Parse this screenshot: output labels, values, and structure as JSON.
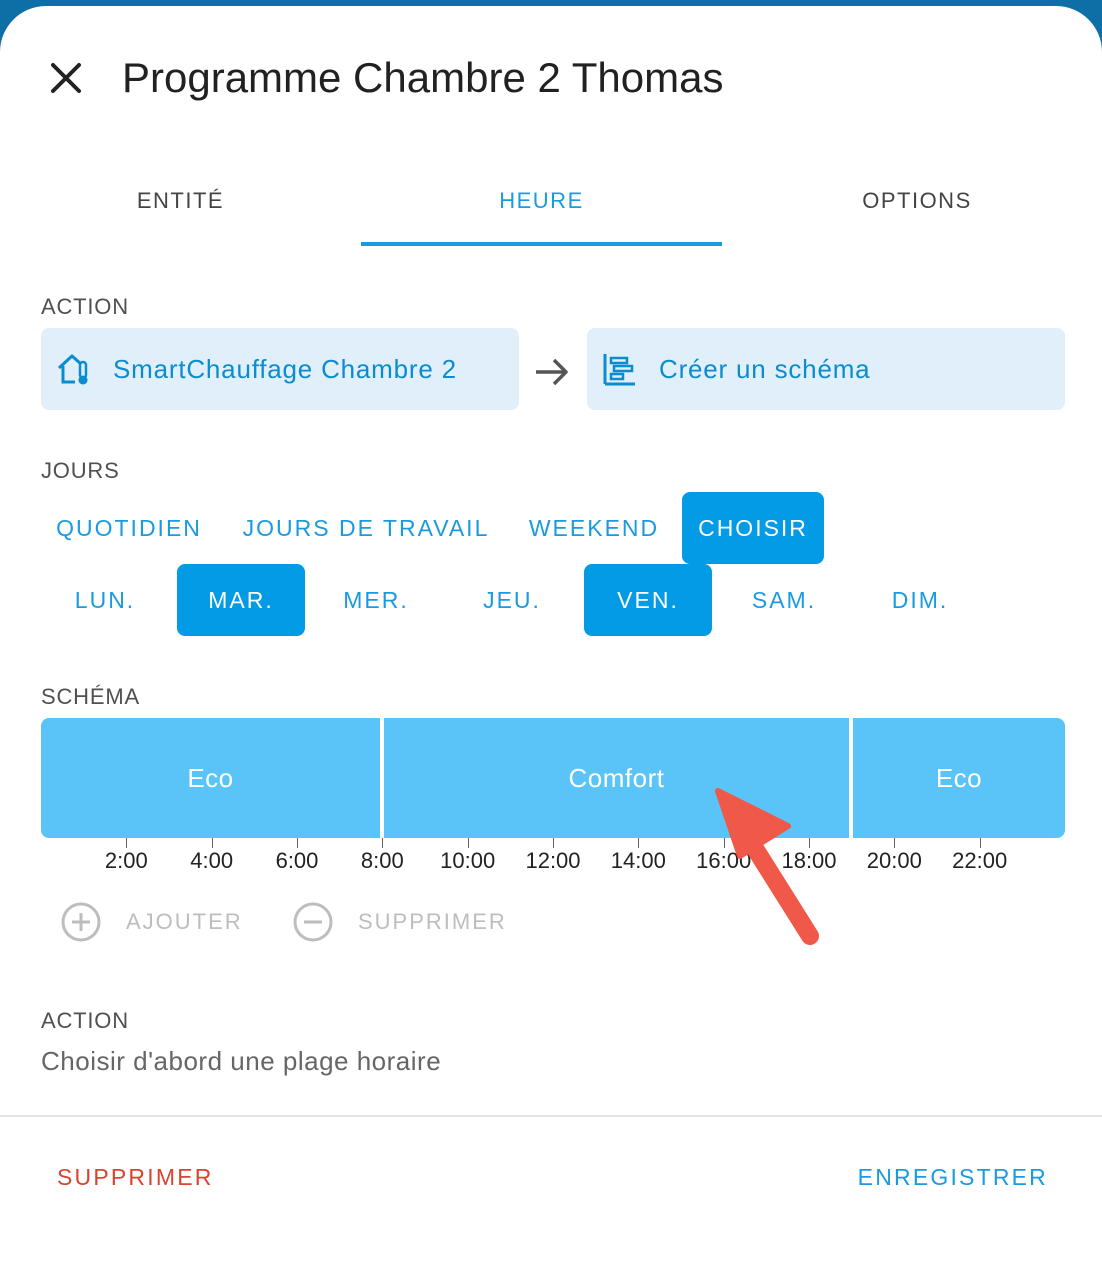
{
  "dialog": {
    "title": "Programme Chambre 2 Thomas"
  },
  "tabs": [
    {
      "label": "ENTITÉ"
    },
    {
      "label": "HEURE"
    },
    {
      "label": "OPTIONS"
    }
  ],
  "action": {
    "label": "ACTION",
    "entity": "SmartChauffage Chambre 2",
    "service": "Créer un schéma"
  },
  "days": {
    "label": "JOURS",
    "modes": [
      "QUOTIDIEN",
      "JOURS DE TRAVAIL",
      "WEEKEND",
      "CHOISIR"
    ],
    "selected_mode": "CHOISIR",
    "weekdays": [
      "LUN.",
      "MAR.",
      "MER.",
      "JEU.",
      "VEN.",
      "SAM.",
      "DIM."
    ],
    "selected_weekdays": [
      "MAR.",
      "VEN."
    ]
  },
  "schema": {
    "label": "SCHÉMA",
    "slots": [
      {
        "label": "Eco",
        "start": "0:00",
        "end": "8:00"
      },
      {
        "label": "Comfort",
        "start": "8:00",
        "end": "19:00"
      },
      {
        "label": "Eco",
        "start": "19:00",
        "end": "24:00"
      }
    ],
    "ticks": [
      "2:00",
      "4:00",
      "6:00",
      "8:00",
      "10:00",
      "12:00",
      "14:00",
      "16:00",
      "18:00",
      "20:00",
      "22:00"
    ],
    "add_label": "AJOUTER",
    "remove_label": "SUPPRIMER"
  },
  "slot_action": {
    "label": "ACTION",
    "hint": "Choisir d'abord une plage horaire"
  },
  "footer": {
    "delete_label": "SUPPRIMER",
    "save_label": "ENREGISTRER"
  },
  "colors": {
    "accent": "#1a9be0",
    "selected_button": "#039be5",
    "slot": "#5ac4f8",
    "chip_bg": "#e0effa",
    "danger": "#d9432f",
    "annotation_arrow": "#f0584a"
  },
  "icons": [
    "close-icon",
    "home-thermometer-icon",
    "arrow-right-icon",
    "schema-icon",
    "plus-circle-icon",
    "minus-circle-icon"
  ]
}
